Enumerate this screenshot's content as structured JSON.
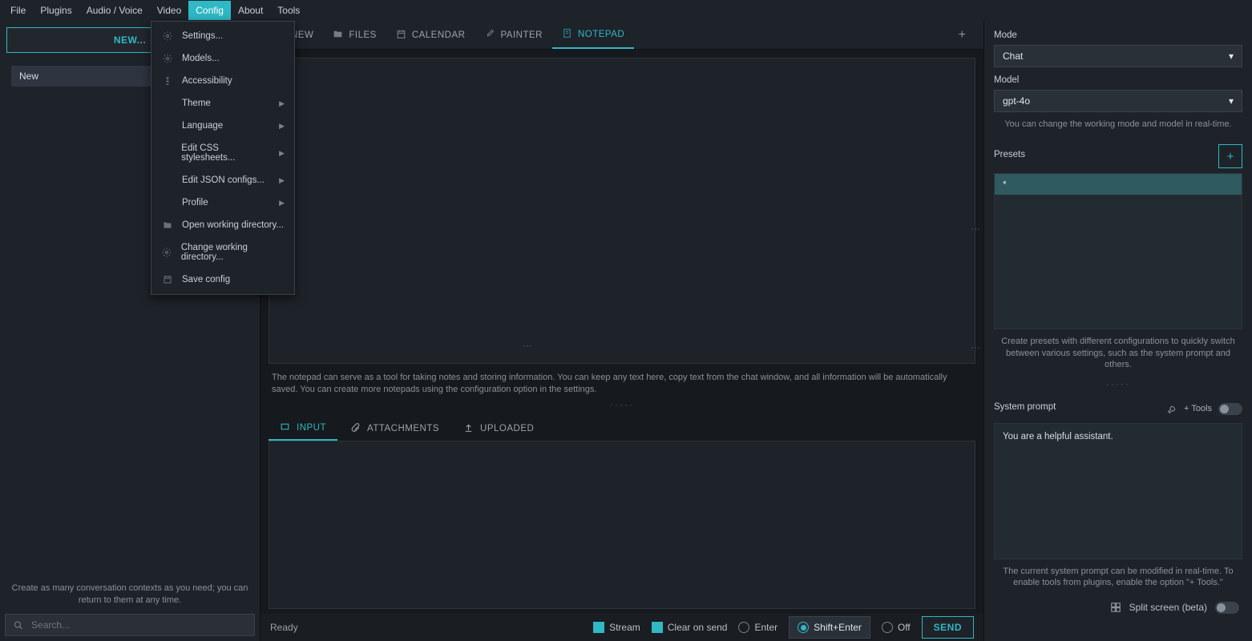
{
  "menubar": [
    "File",
    "Plugins",
    "Audio / Voice",
    "Video",
    "Config",
    "About",
    "Tools"
  ],
  "menubar_active": 4,
  "config_menu": [
    {
      "label": "Settings...",
      "icon": "gear"
    },
    {
      "label": "Models...",
      "icon": "gear"
    },
    {
      "label": "Accessibility",
      "icon": "person"
    },
    {
      "label": "Theme",
      "sub": true
    },
    {
      "label": "Language",
      "sub": true
    },
    {
      "label": "Edit CSS stylesheets...",
      "sub": true
    },
    {
      "label": "Edit JSON configs...",
      "sub": true
    },
    {
      "label": "Profile",
      "sub": true
    },
    {
      "label": "Open working directory...",
      "icon": "folder"
    },
    {
      "label": "Change working directory...",
      "icon": "gear"
    },
    {
      "label": "Save config",
      "icon": "save"
    }
  ],
  "sidebar": {
    "new_btn": "NEW...",
    "items": [
      "New"
    ],
    "hint": "Create as many conversation contexts as you need; you can return to them at any time.",
    "search_ph": "Search..."
  },
  "tabs": {
    "items": [
      {
        "label": "NEW",
        "icon": "chat"
      },
      {
        "label": "FILES",
        "icon": "folder"
      },
      {
        "label": "CALENDAR",
        "icon": "calendar"
      },
      {
        "label": "PAINTER",
        "icon": "brush"
      },
      {
        "label": "NOTEPAD",
        "icon": "note"
      }
    ],
    "active": 4
  },
  "notepad_hint": "The notepad can serve as a tool for taking notes and storing information. You can keep any text here, copy text from the chat window, and all information will be automatically saved. You can create more notepads using the configuration option in the settings.",
  "input_tabs": {
    "items": [
      "INPUT",
      "ATTACHMENTS",
      "UPLOADED"
    ],
    "active": 0
  },
  "status": {
    "ready": "Ready",
    "stream": "Stream",
    "clear": "Clear on send",
    "enter": "Enter",
    "shiftenter": "Shift+Enter",
    "off": "Off",
    "send": "SEND"
  },
  "right": {
    "mode_lbl": "Mode",
    "mode_val": "Chat",
    "model_lbl": "Model",
    "model_val": "gpt-4o",
    "mode_hint": "You can change the working mode and model in real-time.",
    "presets_lbl": "Presets",
    "preset_row": "*",
    "presets_hint": "Create presets with different configurations to quickly switch between various settings, such as the system prompt and others.",
    "sys_lbl": "System prompt",
    "tools_lbl": "+ Tools",
    "sys_val": "You are a helpful assistant.",
    "sys_hint": "The current system prompt can be modified in real-time. To enable tools from plugins, enable the option \"+ Tools.\"",
    "split_lbl": "Split screen (beta)"
  }
}
